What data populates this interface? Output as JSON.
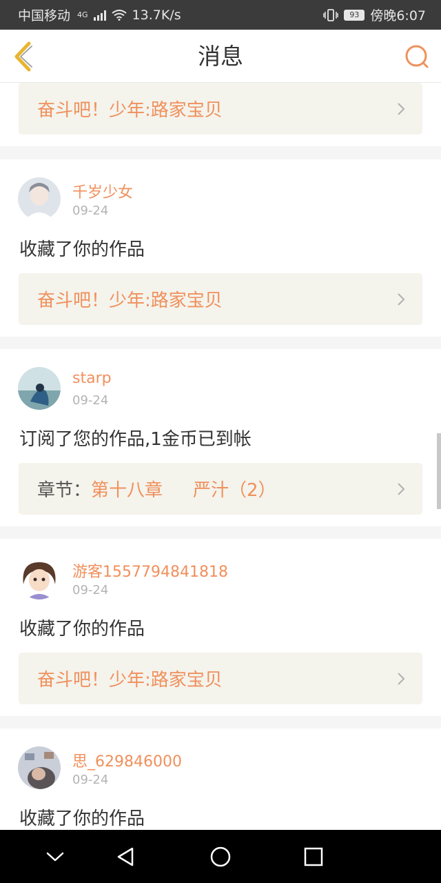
{
  "status_bar": {
    "carrier": "中国移动",
    "network": "4G",
    "speed": "13.7K/s",
    "battery": "93",
    "time": "傍晚6:07"
  },
  "header": {
    "title": "消息",
    "back_icon": "chevron-left-icon",
    "search_icon": "search-icon"
  },
  "colors": {
    "accent": "#f0905c",
    "back_icon": "#e8b530",
    "work_bg": "#f4f3ec"
  },
  "messages": [
    {
      "work_title": "奋斗吧！少年:路家宝贝"
    },
    {
      "username": "千岁少女",
      "date": "09-24",
      "action": "收藏了你的作品",
      "work_title": "奋斗吧！少年:路家宝贝"
    },
    {
      "username": "starp",
      "date": "09-24",
      "action": "订阅了您的作品,1金币已到帐",
      "chapter_label": "章节：",
      "chapter_name": "第十八章",
      "chapter_title": "严汁（2）"
    },
    {
      "username": "游客1557794841818",
      "date": "09-24",
      "action": "收藏了你的作品",
      "work_title": "奋斗吧！少年:路家宝贝"
    },
    {
      "username": "思_629846000",
      "date": "09-24",
      "action": "收藏了你的作品"
    }
  ]
}
